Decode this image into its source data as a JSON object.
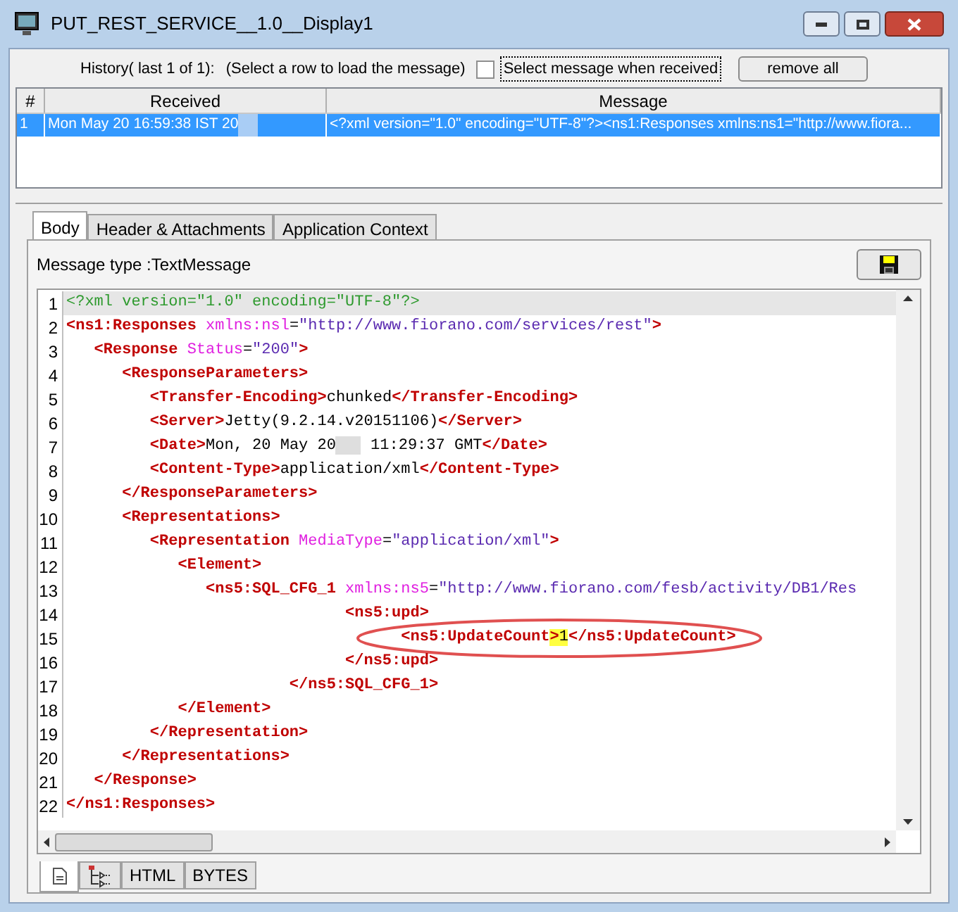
{
  "window": {
    "title": "PUT_REST_SERVICE__1.0__Display1"
  },
  "history": {
    "label": "History( last 1 of 1):",
    "hint": "(Select a row to load the message)",
    "select_when_received": {
      "label": "Select message when received",
      "checked": false
    },
    "remove_button": "remove all"
  },
  "table": {
    "columns": [
      "#",
      "Received",
      "Message"
    ],
    "rows": [
      {
        "selected": true,
        "cells": [
          "1",
          "Mon May 20 16:59:38 IST 20",
          "<?xml version=\"1.0\" encoding=\"UTF-8\"?><ns1:Responses xmlns:ns1=\"http://www.fiora..."
        ],
        "redacted_after_received": true
      }
    ]
  },
  "tabs": [
    {
      "label": "Body",
      "selected": true
    },
    {
      "label": "Header & Attachments",
      "selected": false
    },
    {
      "label": "Application Context",
      "selected": false
    }
  ],
  "message_type": "Message type :TextMessage",
  "editor": {
    "lines": [
      {
        "number": "1",
        "current": true,
        "tokens": [
          {
            "kind": "pi",
            "text": "<?xml version=\"1.0\" encoding=\"UTF-8\"?>"
          }
        ]
      },
      {
        "number": "2",
        "current": false,
        "tokens": [
          {
            "kind": "tag",
            "text": "<ns1:Responses"
          },
          {
            "kind": "attr",
            "text": " xmlns:nsl"
          },
          {
            "kind": "text",
            "text": "="
          },
          {
            "kind": "value",
            "text": "\"http://www.fiorano.com/services/rest\""
          },
          {
            "kind": "tag",
            "text": ">"
          }
        ]
      },
      {
        "number": "3",
        "current": false,
        "tokens": [
          {
            "kind": "tag",
            "text": "   <Response"
          },
          {
            "kind": "attr",
            "text": " Status"
          },
          {
            "kind": "text",
            "text": "="
          },
          {
            "kind": "value",
            "text": "\"200\""
          },
          {
            "kind": "tag",
            "text": ">"
          }
        ]
      },
      {
        "number": "4",
        "current": false,
        "tokens": [
          {
            "kind": "tag",
            "text": "      <ResponseParameters>"
          }
        ]
      },
      {
        "number": "5",
        "current": false,
        "tokens": [
          {
            "kind": "tag",
            "text": "         <Transfer-Encoding>"
          },
          {
            "kind": "text",
            "text": "chunked"
          },
          {
            "kind": "tag",
            "text": "</Transfer-Encoding>"
          }
        ]
      },
      {
        "number": "6",
        "current": false,
        "tokens": [
          {
            "kind": "tag",
            "text": "         <Server>"
          },
          {
            "kind": "text",
            "text": "Jetty(9.2.14.v20151106)"
          },
          {
            "kind": "tag",
            "text": "</Server>"
          }
        ]
      },
      {
        "number": "7",
        "current": false,
        "tokens": [
          {
            "kind": "tag",
            "text": "         <Date>"
          },
          {
            "kind": "text",
            "text": "Mon, 20 May 20"
          },
          {
            "kind": "redaction"
          },
          {
            "kind": "text",
            "text": " 11:29:37 GMT"
          },
          {
            "kind": "tag",
            "text": "</Date>"
          }
        ]
      },
      {
        "number": "8",
        "current": false,
        "tokens": [
          {
            "kind": "tag",
            "text": "         <Content-Type>"
          },
          {
            "kind": "text",
            "text": "application/xml"
          },
          {
            "kind": "tag",
            "text": "</Content-Type>"
          }
        ]
      },
      {
        "number": "9",
        "current": false,
        "tokens": [
          {
            "kind": "tag",
            "text": "      </ResponseParameters>"
          }
        ]
      },
      {
        "number": "10",
        "current": false,
        "tokens": [
          {
            "kind": "tag",
            "text": "      <Representations>"
          }
        ]
      },
      {
        "number": "11",
        "current": false,
        "tokens": [
          {
            "kind": "tag",
            "text": "         <Representation"
          },
          {
            "kind": "attr",
            "text": " MediaType"
          },
          {
            "kind": "text",
            "text": "="
          },
          {
            "kind": "value",
            "text": "\"application/xml\""
          },
          {
            "kind": "tag",
            "text": ">"
          }
        ]
      },
      {
        "number": "12",
        "current": false,
        "tokens": [
          {
            "kind": "tag",
            "text": "            <Element>"
          }
        ]
      },
      {
        "number": "13",
        "current": false,
        "tokens": [
          {
            "kind": "tag",
            "text": "               <ns5:SQL_CFG_1"
          },
          {
            "kind": "attr",
            "text": " xmlns:ns5"
          },
          {
            "kind": "text",
            "text": "="
          },
          {
            "kind": "value",
            "text": "\"http://www.fiorano.com/fesb/activity/DB1/Res"
          }
        ]
      },
      {
        "number": "14",
        "current": false,
        "tokens": [
          {
            "kind": "tag",
            "text": "                              <ns5:upd>"
          }
        ]
      },
      {
        "number": "15",
        "current": false,
        "circled": true,
        "tokens": [
          {
            "kind": "tag",
            "text": "                                    <ns5:UpdateCount"
          },
          {
            "kind": "tag",
            "text": ">",
            "highlight": true
          },
          {
            "kind": "text",
            "text": "1",
            "highlight": true
          },
          {
            "kind": "tag",
            "text": "</ns5:UpdateCount>"
          }
        ]
      },
      {
        "number": "16",
        "current": false,
        "tokens": [
          {
            "kind": "tag",
            "text": "                              </ns5:upd>"
          }
        ]
      },
      {
        "number": "17",
        "current": false,
        "tokens": [
          {
            "kind": "tag",
            "text": "                        </ns5:SQL_CFG_1>"
          }
        ]
      },
      {
        "number": "18",
        "current": false,
        "tokens": [
          {
            "kind": "tag",
            "text": "            </Element>"
          }
        ]
      },
      {
        "number": "19",
        "current": false,
        "tokens": [
          {
            "kind": "tag",
            "text": "         </Representation>"
          }
        ]
      },
      {
        "number": "20",
        "current": false,
        "tokens": [
          {
            "kind": "tag",
            "text": "      </Representations>"
          }
        ]
      },
      {
        "number": "21",
        "current": false,
        "tokens": [
          {
            "kind": "tag",
            "text": "   </Response>"
          }
        ]
      },
      {
        "number": "22",
        "current": false,
        "tokens": [
          {
            "kind": "tag",
            "text": "</ns1:Responses>"
          }
        ]
      }
    ]
  },
  "view_tabs": [
    {
      "kind": "document",
      "selected": true
    },
    {
      "kind": "tree",
      "selected": false
    },
    {
      "kind": "text",
      "label": "HTML",
      "selected": false
    },
    {
      "kind": "text",
      "label": "BYTES",
      "selected": false
    }
  ]
}
